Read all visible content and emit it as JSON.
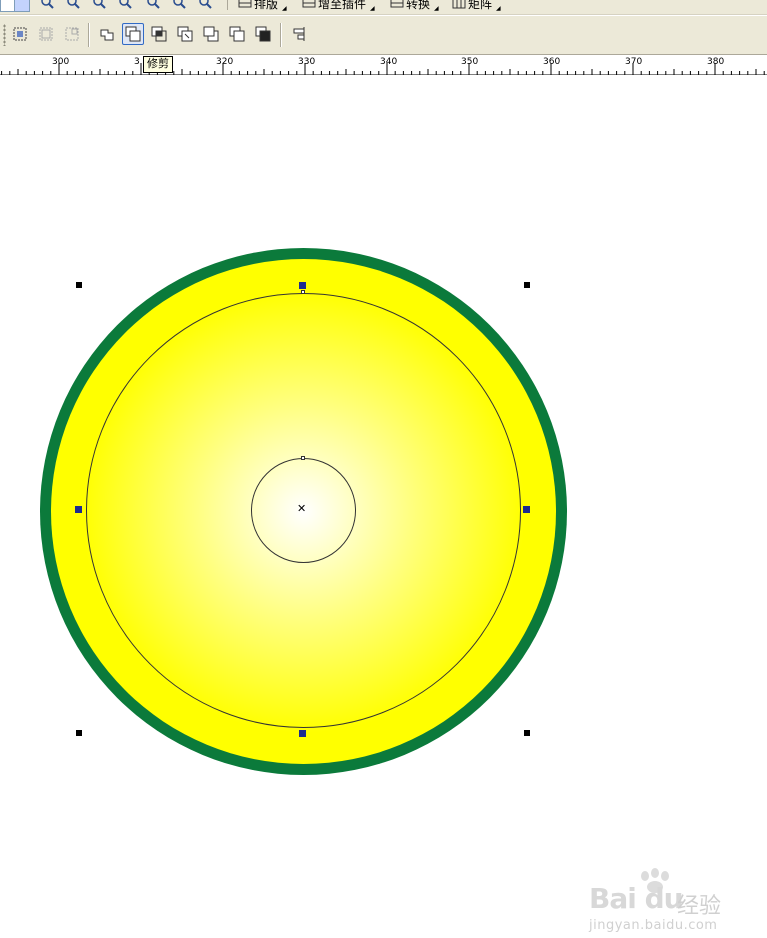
{
  "menu_toolbar": {
    "items": [
      {
        "label": "排版"
      },
      {
        "label": "增至插件"
      },
      {
        "label": "转换"
      },
      {
        "label": "矩阵"
      }
    ]
  },
  "shaping_toolbar": {
    "tooltip": "修剪"
  },
  "ruler": {
    "labels": [
      "300",
      "3",
      "320",
      "330",
      "340",
      "350",
      "360",
      "370",
      "380"
    ]
  },
  "watermark": {
    "logo": "Bai du",
    "cn": "经验",
    "url": "jingyan.baidu.com"
  },
  "colors": {
    "outer_ring": "#0b7a3b",
    "fill_center": "#ffffff",
    "fill_main": "#ffff00",
    "fill_edge": "#9fd116",
    "handle_blue": "#1c2b8f",
    "toolbar_bg": "#ece9d8"
  }
}
